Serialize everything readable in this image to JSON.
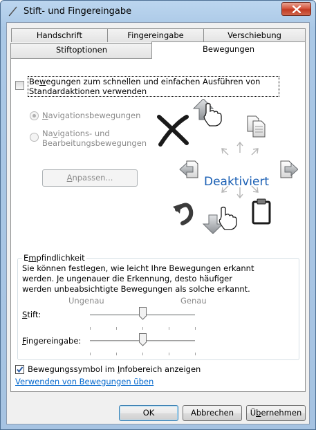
{
  "window": {
    "title": "Stift- und Fingereingabe"
  },
  "tabs": {
    "row1": [
      "Handschrift",
      "Fingereingabe",
      "Verschiebung"
    ],
    "row2": [
      "Stiftoptionen",
      "Bewegungen"
    ]
  },
  "gestures": {
    "enable_line1_pre": "Be",
    "enable_line1_u": "w",
    "enable_line1_post": "egungen zum schnellen und einfachen Ausführen von",
    "enable_line2": "Standardaktionen verwenden",
    "enable_checked": false,
    "radio1_u": "N",
    "radio1_rest": "avigationsbewegungen",
    "radio2_pre": "Na",
    "radio2_u": "v",
    "radio2_rest": "igations- und",
    "radio2_line2": "Bearbeitungsbewegungen",
    "customize_u": "A",
    "customize_rest": "npassen...",
    "illustration_label": "Deaktiviert"
  },
  "sensitivity": {
    "legend_pre": "E",
    "legend_u": "m",
    "legend_rest": "pfindlichkeit",
    "desc1": "Sie können festlegen, wie leicht Ihre Bewegungen erkannt",
    "desc2": "werden. Je ungenauer die Erkennung, desto häufiger",
    "desc3": "werden unbeabsichtigte Bewegungen als solche erkannt.",
    "low_label": "Ungenau",
    "high_label": "Genau",
    "pen_u": "S",
    "pen_rest": "tift:",
    "touch_u": "F",
    "touch_rest": "ingereingabe:",
    "pen_level": 0.5,
    "touch_level": 0.5
  },
  "notify": {
    "label_pre": "Bewegungssymbol im ",
    "label_u": "I",
    "label_rest": "nfobereich anzeigen",
    "checked": true
  },
  "practice_link": "Verwenden von Bewegungen üben",
  "buttons": {
    "ok": "OK",
    "cancel": "Abbrechen",
    "apply_pre": "Ü",
    "apply_u": "b",
    "apply_rest": "ernehmen"
  },
  "colors": {
    "accent": "#1a5fb4",
    "link": "#0066cc",
    "close": "#c8402a"
  }
}
